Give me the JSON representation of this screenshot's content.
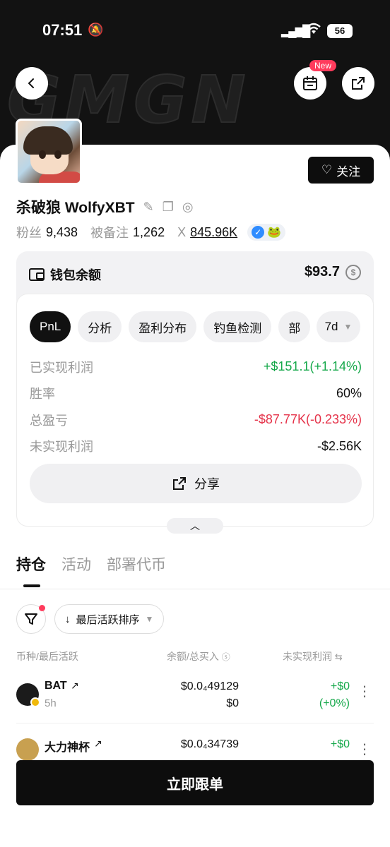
{
  "status": {
    "time": "07:51",
    "battery": "56"
  },
  "header": {
    "new_badge": "New"
  },
  "profile": {
    "name": "杀破狼 WolfyXBT",
    "fans_label": "粉丝",
    "fans_value": "9,438",
    "noted_label": "被备注",
    "noted_value": "1,262",
    "x_label": "X",
    "x_value": "845.96K",
    "follow_label": "关注"
  },
  "wallet": {
    "title": "钱包余额",
    "amount": "$93.7",
    "tabs": [
      "PnL",
      "分析",
      "盈利分布",
      "钓鱼检测",
      "部"
    ],
    "period": "7d",
    "metrics": [
      {
        "label": "已实现利润",
        "value": "+$151.1(+1.14%)"
      },
      {
        "label": "胜率",
        "value": "60%"
      },
      {
        "label": "总盈亏",
        "value": "-$87.77K(-0.233%)"
      },
      {
        "label": "未实现利润",
        "value": "-$2.56K"
      }
    ],
    "share_label": "分享"
  },
  "sections": {
    "tabs": [
      "持仓",
      "活动",
      "部署代币"
    ]
  },
  "filters": {
    "sort_label": "最后活跃排序"
  },
  "table": {
    "headers": [
      "币种/最后活跃",
      "余额/总买入",
      "未实现利润"
    ],
    "rows": [
      {
        "name": "BAT",
        "time": "5h",
        "balance": "$0.0₄49129",
        "bought": "$0",
        "pnl": "+$0",
        "pnl_pct": "(+0%)"
      },
      {
        "name": "大力神杯",
        "time": "",
        "balance": "$0.0₄34739",
        "bought": "",
        "pnl": "+$0",
        "pnl_pct": ""
      }
    ]
  },
  "cta": {
    "label": "立即跟单"
  },
  "colors": {
    "positive": "#15a84a",
    "negative": "#e5334a",
    "accent": "#ff3b5c"
  }
}
